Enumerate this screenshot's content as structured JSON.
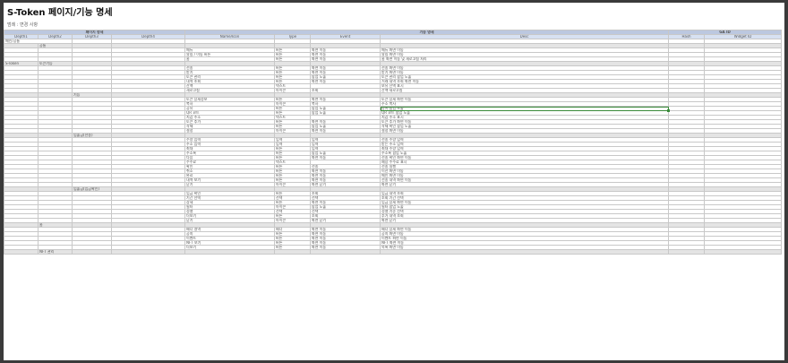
{
  "title": "S-Token 페이지/기능 명세",
  "subtitle": "범례 : 변경 사항",
  "group_headers": {
    "page": "페이지 명세",
    "function": "기능 명세",
    "ga": "GA ID"
  },
  "column_headers": [
    "Depth1",
    "Depth2",
    "Depth3",
    "Depth4",
    "Name/Icon",
    "Type",
    "Event",
    "Desc",
    "Hash",
    "Widget ID"
  ],
  "first_row": "메인/공통",
  "rows": [
    {
      "sec": true,
      "d2": "공통"
    },
    {
      "name": "메뉴",
      "type": "버튼",
      "event": "화면 이동",
      "desc": "메뉴 화면 이동"
    },
    {
      "name": "알림 / 이동 버튼",
      "type": "버튼",
      "event": "화면 이동",
      "desc": "알림 화면 이동"
    },
    {
      "name": "홈",
      "type": "버튼",
      "event": "화면 이동",
      "desc": "홈 화면 이동 및 새로고침 처리"
    },
    {
      "sec": true,
      "d1": "S-Token",
      "d2": "토큰기능"
    },
    {
      "name": "전송",
      "type": "버튼",
      "event": "화면 이동",
      "desc": "전송 화면 이동"
    },
    {
      "name": "받기",
      "type": "버튼",
      "event": "화면 이동",
      "desc": "받기 화면 이동"
    },
    {
      "name": "토큰 관리",
      "type": "버튼",
      "event": "팝업 노출",
      "desc": "토큰 관리 팝업 노출"
    },
    {
      "name": "내역 조회",
      "type": "버튼",
      "event": "화면 이동",
      "desc": "거래 내역 조회 화면 이동"
    },
    {
      "name": "잔액",
      "type": "텍스트",
      "event": "",
      "desc": "보유 잔액 표시"
    },
    {
      "name": "새로고침",
      "type": "아이콘",
      "event": "조회",
      "desc": "잔액 새로고침"
    },
    {
      "sec": true,
      "d3": "기능"
    },
    {
      "name": "토큰 상세정보",
      "type": "버튼",
      "event": "화면 이동",
      "desc": "토큰 상세 화면 이동"
    },
    {
      "name": "복사",
      "type": "아이콘",
      "event": "복사",
      "desc": "주소 복사"
    },
    {
      "name": "공유",
      "type": "버튼",
      "event": "팝업 노출",
      "desc": "공유 팝업 노출",
      "sel": true
    },
    {
      "name": "QR 코드",
      "type": "버튼",
      "event": "팝업 노출",
      "desc": "QR 코드 팝업 노출"
    },
    {
      "name": "지갑 주소",
      "type": "텍스트",
      "event": "",
      "desc": "지갑 주소 표시"
    },
    {
      "name": "토큰 추가",
      "type": "버튼",
      "event": "화면 이동",
      "desc": "토큰 추가 화면 이동"
    },
    {
      "name": "삭제",
      "type": "버튼",
      "event": "팝업 노출",
      "desc": "삭제 확인 팝업 노출"
    },
    {
      "name": "설정",
      "type": "아이콘",
      "event": "화면 이동",
      "desc": "설정 화면 이동"
    },
    {
      "sec": true,
      "d3": "입출금(전송)"
    },
    {
      "name": "수량 입력",
      "type": "입력",
      "event": "입력",
      "desc": "전송 수량 입력"
    },
    {
      "name": "주소 입력",
      "type": "입력",
      "event": "입력",
      "desc": "받는 주소 입력"
    },
    {
      "name": "최대",
      "type": "버튼",
      "event": "입력",
      "desc": "최대 수량 입력"
    },
    {
      "name": "주소록",
      "type": "버튼",
      "event": "팝업 노출",
      "desc": "주소록 팝업 노출"
    },
    {
      "name": "다음",
      "type": "버튼",
      "event": "화면 이동",
      "desc": "전송 확인 화면 이동"
    },
    {
      "name": "수수료",
      "type": "텍스트",
      "event": "",
      "desc": "예상 수수료 표시"
    },
    {
      "name": "확인",
      "type": "버튼",
      "event": "전송",
      "desc": "전송 실행"
    },
    {
      "name": "취소",
      "type": "버튼",
      "event": "화면 이동",
      "desc": "이전 화면 이동"
    },
    {
      "name": "완료",
      "type": "버튼",
      "event": "화면 이동",
      "desc": "메인 화면 이동"
    },
    {
      "name": "내역 보기",
      "type": "버튼",
      "event": "화면 이동",
      "desc": "전송 내역 화면 이동"
    },
    {
      "name": "닫기",
      "type": "아이콘",
      "event": "화면 닫기",
      "desc": "화면 닫기"
    },
    {
      "sec": true,
      "d3": "입출금(입금확인)"
    },
    {
      "name": "입금 확인",
      "type": "버튼",
      "event": "조회",
      "desc": "입금 내역 조회"
    },
    {
      "name": "기간 선택",
      "type": "선택",
      "event": "선택",
      "desc": "조회 기간 선택"
    },
    {
      "name": "상세",
      "type": "버튼",
      "event": "화면 이동",
      "desc": "입금 상세 화면 이동"
    },
    {
      "name": "필터",
      "type": "아이콘",
      "event": "팝업 노출",
      "desc": "필터 팝업 노출"
    },
    {
      "name": "정렬",
      "type": "선택",
      "event": "선택",
      "desc": "정렬 기준 선택"
    },
    {
      "name": "더보기",
      "type": "버튼",
      "event": "조회",
      "desc": "추가 내역 조회"
    },
    {
      "name": "닫기",
      "type": "아이콘",
      "event": "화면 닫기",
      "desc": "화면 닫기"
    },
    {
      "sec": true,
      "d2": "홈"
    },
    {
      "name": "배너 영역",
      "type": "배너",
      "event": "화면 이동",
      "desc": "배너 상세 화면 이동"
    },
    {
      "name": "공지",
      "type": "버튼",
      "event": "화면 이동",
      "desc": "공지 화면 이동"
    },
    {
      "name": "이벤트",
      "type": "버튼",
      "event": "화면 이동",
      "desc": "이벤트 화면 이동"
    },
    {
      "name": "NFT 보기",
      "type": "버튼",
      "event": "화면 이동",
      "desc": "NFT 화면 이동"
    },
    {
      "name": "더보기",
      "type": "버튼",
      "event": "화면 이동",
      "desc": "목록 화면 이동"
    },
    {
      "sec": true,
      "d2": "NFT 관리"
    }
  ]
}
